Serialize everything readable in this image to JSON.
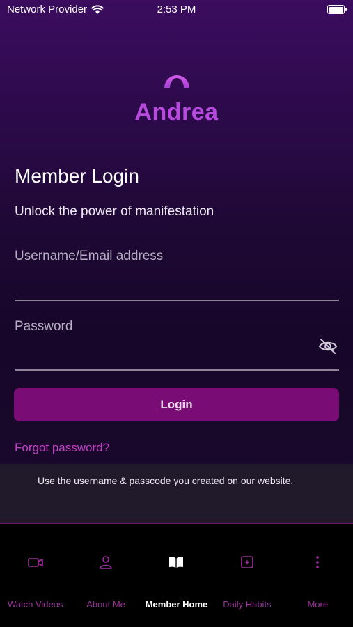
{
  "status_bar": {
    "carrier": "Network Provider",
    "time": "2:53 PM",
    "wifi_icon": "wifi-icon",
    "battery_icon": "battery-full-icon"
  },
  "brand": {
    "logo_icon": "arch-logo-icon",
    "name": "Andrea",
    "color": "#b84ae0"
  },
  "login": {
    "title": "Member Login",
    "subtitle": "Unlock the power of manifestation",
    "username_label": "Username/Email address",
    "username_value": "",
    "password_label": "Password",
    "password_value": "",
    "password_toggle_icon": "eye-slash-icon",
    "button_label": "Login",
    "button_color": "#7a0c76",
    "forgot_password": "Forgot password?"
  },
  "info": {
    "text": "Use the username & passcode you created on our website."
  },
  "tab_bar": {
    "accent": "#a22d9c",
    "items": [
      {
        "label": "Watch Videos",
        "icon": "video-camera-icon",
        "active": false
      },
      {
        "label": "About Me",
        "icon": "person-icon",
        "active": false
      },
      {
        "label": "Member Home",
        "icon": "open-book-icon",
        "active": true
      },
      {
        "label": "Daily Habits",
        "icon": "sparkle-square-icon",
        "active": false
      },
      {
        "label": "More",
        "icon": "more-vertical-icon",
        "active": false
      }
    ]
  }
}
